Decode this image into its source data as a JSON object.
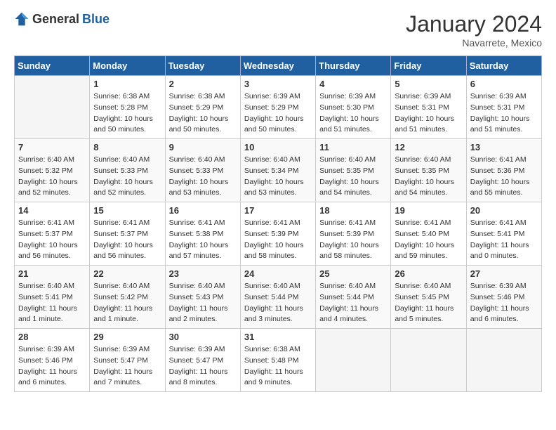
{
  "header": {
    "logo_general": "General",
    "logo_blue": "Blue",
    "month_title": "January 2024",
    "subtitle": "Navarrete, Mexico"
  },
  "days_of_week": [
    "Sunday",
    "Monday",
    "Tuesday",
    "Wednesday",
    "Thursday",
    "Friday",
    "Saturday"
  ],
  "weeks": [
    [
      {
        "day": "",
        "sunrise": "",
        "sunset": "",
        "daylight": ""
      },
      {
        "day": "1",
        "sunrise": "Sunrise: 6:38 AM",
        "sunset": "Sunset: 5:28 PM",
        "daylight": "Daylight: 10 hours and 50 minutes."
      },
      {
        "day": "2",
        "sunrise": "Sunrise: 6:38 AM",
        "sunset": "Sunset: 5:29 PM",
        "daylight": "Daylight: 10 hours and 50 minutes."
      },
      {
        "day": "3",
        "sunrise": "Sunrise: 6:39 AM",
        "sunset": "Sunset: 5:29 PM",
        "daylight": "Daylight: 10 hours and 50 minutes."
      },
      {
        "day": "4",
        "sunrise": "Sunrise: 6:39 AM",
        "sunset": "Sunset: 5:30 PM",
        "daylight": "Daylight: 10 hours and 51 minutes."
      },
      {
        "day": "5",
        "sunrise": "Sunrise: 6:39 AM",
        "sunset": "Sunset: 5:31 PM",
        "daylight": "Daylight: 10 hours and 51 minutes."
      },
      {
        "day": "6",
        "sunrise": "Sunrise: 6:39 AM",
        "sunset": "Sunset: 5:31 PM",
        "daylight": "Daylight: 10 hours and 51 minutes."
      }
    ],
    [
      {
        "day": "7",
        "sunrise": "Sunrise: 6:40 AM",
        "sunset": "Sunset: 5:32 PM",
        "daylight": "Daylight: 10 hours and 52 minutes."
      },
      {
        "day": "8",
        "sunrise": "Sunrise: 6:40 AM",
        "sunset": "Sunset: 5:33 PM",
        "daylight": "Daylight: 10 hours and 52 minutes."
      },
      {
        "day": "9",
        "sunrise": "Sunrise: 6:40 AM",
        "sunset": "Sunset: 5:33 PM",
        "daylight": "Daylight: 10 hours and 53 minutes."
      },
      {
        "day": "10",
        "sunrise": "Sunrise: 6:40 AM",
        "sunset": "Sunset: 5:34 PM",
        "daylight": "Daylight: 10 hours and 53 minutes."
      },
      {
        "day": "11",
        "sunrise": "Sunrise: 6:40 AM",
        "sunset": "Sunset: 5:35 PM",
        "daylight": "Daylight: 10 hours and 54 minutes."
      },
      {
        "day": "12",
        "sunrise": "Sunrise: 6:40 AM",
        "sunset": "Sunset: 5:35 PM",
        "daylight": "Daylight: 10 hours and 54 minutes."
      },
      {
        "day": "13",
        "sunrise": "Sunrise: 6:41 AM",
        "sunset": "Sunset: 5:36 PM",
        "daylight": "Daylight: 10 hours and 55 minutes."
      }
    ],
    [
      {
        "day": "14",
        "sunrise": "Sunrise: 6:41 AM",
        "sunset": "Sunset: 5:37 PM",
        "daylight": "Daylight: 10 hours and 56 minutes."
      },
      {
        "day": "15",
        "sunrise": "Sunrise: 6:41 AM",
        "sunset": "Sunset: 5:37 PM",
        "daylight": "Daylight: 10 hours and 56 minutes."
      },
      {
        "day": "16",
        "sunrise": "Sunrise: 6:41 AM",
        "sunset": "Sunset: 5:38 PM",
        "daylight": "Daylight: 10 hours and 57 minutes."
      },
      {
        "day": "17",
        "sunrise": "Sunrise: 6:41 AM",
        "sunset": "Sunset: 5:39 PM",
        "daylight": "Daylight: 10 hours and 58 minutes."
      },
      {
        "day": "18",
        "sunrise": "Sunrise: 6:41 AM",
        "sunset": "Sunset: 5:39 PM",
        "daylight": "Daylight: 10 hours and 58 minutes."
      },
      {
        "day": "19",
        "sunrise": "Sunrise: 6:41 AM",
        "sunset": "Sunset: 5:40 PM",
        "daylight": "Daylight: 10 hours and 59 minutes."
      },
      {
        "day": "20",
        "sunrise": "Sunrise: 6:41 AM",
        "sunset": "Sunset: 5:41 PM",
        "daylight": "Daylight: 11 hours and 0 minutes."
      }
    ],
    [
      {
        "day": "21",
        "sunrise": "Sunrise: 6:40 AM",
        "sunset": "Sunset: 5:41 PM",
        "daylight": "Daylight: 11 hours and 1 minute."
      },
      {
        "day": "22",
        "sunrise": "Sunrise: 6:40 AM",
        "sunset": "Sunset: 5:42 PM",
        "daylight": "Daylight: 11 hours and 1 minute."
      },
      {
        "day": "23",
        "sunrise": "Sunrise: 6:40 AM",
        "sunset": "Sunset: 5:43 PM",
        "daylight": "Daylight: 11 hours and 2 minutes."
      },
      {
        "day": "24",
        "sunrise": "Sunrise: 6:40 AM",
        "sunset": "Sunset: 5:44 PM",
        "daylight": "Daylight: 11 hours and 3 minutes."
      },
      {
        "day": "25",
        "sunrise": "Sunrise: 6:40 AM",
        "sunset": "Sunset: 5:44 PM",
        "daylight": "Daylight: 11 hours and 4 minutes."
      },
      {
        "day": "26",
        "sunrise": "Sunrise: 6:40 AM",
        "sunset": "Sunset: 5:45 PM",
        "daylight": "Daylight: 11 hours and 5 minutes."
      },
      {
        "day": "27",
        "sunrise": "Sunrise: 6:39 AM",
        "sunset": "Sunset: 5:46 PM",
        "daylight": "Daylight: 11 hours and 6 minutes."
      }
    ],
    [
      {
        "day": "28",
        "sunrise": "Sunrise: 6:39 AM",
        "sunset": "Sunset: 5:46 PM",
        "daylight": "Daylight: 11 hours and 6 minutes."
      },
      {
        "day": "29",
        "sunrise": "Sunrise: 6:39 AM",
        "sunset": "Sunset: 5:47 PM",
        "daylight": "Daylight: 11 hours and 7 minutes."
      },
      {
        "day": "30",
        "sunrise": "Sunrise: 6:39 AM",
        "sunset": "Sunset: 5:47 PM",
        "daylight": "Daylight: 11 hours and 8 minutes."
      },
      {
        "day": "31",
        "sunrise": "Sunrise: 6:38 AM",
        "sunset": "Sunset: 5:48 PM",
        "daylight": "Daylight: 11 hours and 9 minutes."
      },
      {
        "day": "",
        "sunrise": "",
        "sunset": "",
        "daylight": ""
      },
      {
        "day": "",
        "sunrise": "",
        "sunset": "",
        "daylight": ""
      },
      {
        "day": "",
        "sunrise": "",
        "sunset": "",
        "daylight": ""
      }
    ]
  ]
}
